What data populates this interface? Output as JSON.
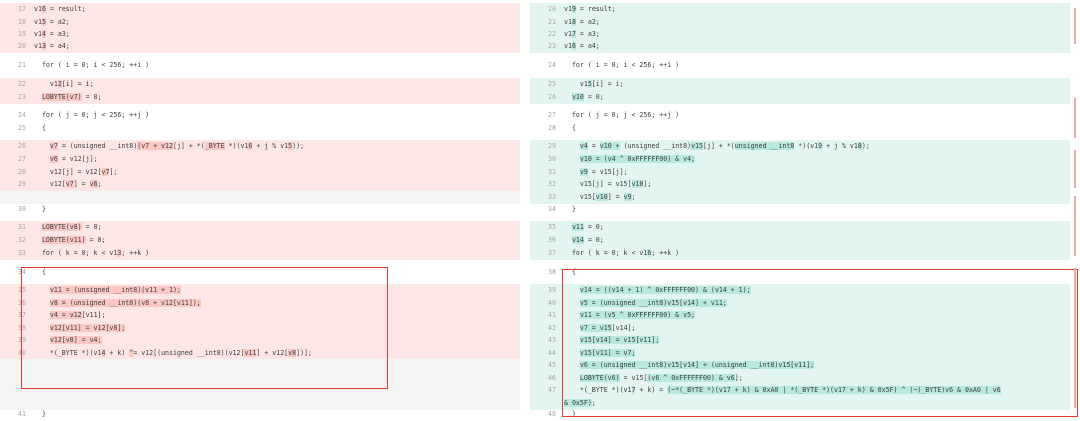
{
  "left": [
    {
      "ln": "17",
      "cls": "del",
      "parts": [
        {
          "t": "v1"
        },
        {
          "t": "6",
          "h": 1
        },
        {
          "t": " = result;"
        }
      ]
    },
    {
      "ln": "18",
      "cls": "del",
      "parts": [
        {
          "t": "v1"
        },
        {
          "t": "5",
          "h": 1
        },
        {
          "t": " = a2;"
        }
      ]
    },
    {
      "ln": "19",
      "cls": "del",
      "parts": [
        {
          "t": "v1"
        },
        {
          "t": "4",
          "h": 1
        },
        {
          "t": " = a3;"
        }
      ]
    },
    {
      "ln": "20",
      "cls": "del",
      "parts": [
        {
          "t": "v1"
        },
        {
          "t": "3",
          "h": 1
        },
        {
          "t": " = a4;"
        }
      ]
    },
    {
      "ln": "21",
      "cls": "",
      "parts": [
        {
          "t": "  for ( i = 0; i < 256; ++i )"
        }
      ]
    },
    {
      "ln": "22",
      "cls": "del",
      "parts": [
        {
          "t": "    v1"
        },
        {
          "t": "2",
          "h": 1
        },
        {
          "t": "[i] = i;"
        }
      ]
    },
    {
      "ln": "23",
      "cls": "del",
      "parts": [
        {
          "t": "  "
        },
        {
          "t": "LOBYTE(v7)",
          "h": 1
        },
        {
          "t": " = 0;"
        }
      ]
    },
    {
      "ln": "24",
      "cls": "",
      "parts": [
        {
          "t": "  for ( j = 0; j < 256; ++j )"
        }
      ]
    },
    {
      "ln": "25",
      "cls": "",
      "parts": [
        {
          "t": "  {"
        }
      ]
    },
    {
      "ln": "26",
      "cls": "del",
      "parts": [
        {
          "t": "    "
        },
        {
          "t": "v7",
          "h": 1
        },
        {
          "t": " = (unsigned __int8)"
        },
        {
          "t": "(v7 + v12",
          "h": 1
        },
        {
          "t": "[j] + *("
        },
        {
          "t": "_BYTE",
          "h": 1
        },
        {
          "t": " *)(v1"
        },
        {
          "t": "6",
          "h": 1
        },
        {
          "t": " + j % v1"
        },
        {
          "t": "5",
          "h": 1
        },
        {
          "t": "));"
        }
      ]
    },
    {
      "ln": "27",
      "cls": "del",
      "parts": [
        {
          "t": "    "
        },
        {
          "t": "v6",
          "h": 1
        },
        {
          "t": " = v12[j];"
        }
      ]
    },
    {
      "ln": "28",
      "cls": "del",
      "parts": [
        {
          "t": "    v12[j] = v12["
        },
        {
          "t": "v7",
          "h": 1
        },
        {
          "t": "];"
        }
      ]
    },
    {
      "ln": "29",
      "cls": "del",
      "parts": [
        {
          "t": "    v12["
        },
        {
          "t": "v7",
          "h": 1
        },
        {
          "t": "] = "
        },
        {
          "t": "v6",
          "h": 1
        },
        {
          "t": ";"
        }
      ]
    },
    {
      "ln": "",
      "cls": "empty",
      "parts": []
    },
    {
      "ln": "30",
      "cls": "",
      "parts": [
        {
          "t": "  }"
        }
      ]
    },
    {
      "ln": "31",
      "cls": "del",
      "parts": [
        {
          "t": "  "
        },
        {
          "t": "LOBYTE(v8)",
          "h": 1
        },
        {
          "t": " = 0;"
        }
      ]
    },
    {
      "ln": "32",
      "cls": "del",
      "parts": [
        {
          "t": "  "
        },
        {
          "t": "LOBYTE(v11)",
          "h": 1
        },
        {
          "t": " = 0;"
        }
      ]
    },
    {
      "ln": "33",
      "cls": "del",
      "parts": [
        {
          "t": "  for ( k = 0; k < v1"
        },
        {
          "t": "3",
          "h": 1
        },
        {
          "t": "; ++k )"
        }
      ]
    },
    {
      "ln": "34",
      "cls": "",
      "parts": [
        {
          "t": "  {"
        }
      ]
    },
    {
      "ln": "35",
      "cls": "del",
      "parts": [
        {
          "t": "    "
        },
        {
          "t": "v11 = (unsigned __int8)(v11 + 1);",
          "h": 1
        }
      ]
    },
    {
      "ln": "36",
      "cls": "del",
      "parts": [
        {
          "t": "    "
        },
        {
          "t": "v8 = (unsigned __int8)(v8 + v12[v11]);",
          "h": 1
        }
      ]
    },
    {
      "ln": "37",
      "cls": "del",
      "parts": [
        {
          "t": "    "
        },
        {
          "t": "v4 = v12",
          "h": 1
        },
        {
          "t": "[v11];"
        }
      ]
    },
    {
      "ln": "38",
      "cls": "del",
      "parts": [
        {
          "t": "    "
        },
        {
          "t": "v12[v11] = v12[v8];",
          "h": 1
        }
      ]
    },
    {
      "ln": "39",
      "cls": "del",
      "parts": [
        {
          "t": "    "
        },
        {
          "t": "v12[v8] = v4;",
          "h": 1
        }
      ]
    },
    {
      "ln": "40",
      "cls": "del",
      "parts": [
        {
          "t": "    *(_BYTE *)(v1"
        },
        {
          "t": "4",
          "h": 1
        },
        {
          "t": " + k) "
        },
        {
          "t": "^",
          "h": 1
        },
        {
          "t": "= v12[(unsigned __int8)(v12["
        },
        {
          "t": "v11",
          "h": 1
        },
        {
          "t": "] + v12["
        },
        {
          "t": "v8",
          "h": 1
        },
        {
          "t": "])];"
        }
      ]
    },
    {
      "ln": "",
      "cls": "empty",
      "parts": []
    },
    {
      "ln": "",
      "cls": "empty",
      "parts": []
    },
    {
      "ln": "",
      "cls": "empty",
      "parts": []
    },
    {
      "ln": "",
      "cls": "empty",
      "parts": []
    },
    {
      "ln": "",
      "cls": "empty",
      "parts": []
    },
    {
      "ln": "",
      "cls": "",
      "parts": []
    },
    {
      "ln": "41",
      "cls": "",
      "parts": [
        {
          "t": "  }"
        }
      ]
    }
  ],
  "right": [
    {
      "ln": "20",
      "cls": "add",
      "parts": [
        {
          "t": "v1"
        },
        {
          "t": "9",
          "h": 1
        },
        {
          "t": " = result;"
        }
      ]
    },
    {
      "ln": "21",
      "cls": "add",
      "parts": [
        {
          "t": "v1"
        },
        {
          "t": "8",
          "h": 1
        },
        {
          "t": " = a2;"
        }
      ]
    },
    {
      "ln": "22",
      "cls": "add",
      "parts": [
        {
          "t": "v1"
        },
        {
          "t": "7",
          "h": 1
        },
        {
          "t": " = a3;"
        }
      ]
    },
    {
      "ln": "23",
      "cls": "add",
      "parts": [
        {
          "t": "v1"
        },
        {
          "t": "6",
          "h": 1
        },
        {
          "t": " = a4;"
        }
      ]
    },
    {
      "ln": "24",
      "cls": "",
      "parts": [
        {
          "t": "  for ( i = 0; i < 256; ++i )"
        }
      ]
    },
    {
      "ln": "25",
      "cls": "add",
      "parts": [
        {
          "t": "    v1"
        },
        {
          "t": "5",
          "h": 1
        },
        {
          "t": "[i] = i;"
        }
      ]
    },
    {
      "ln": "26",
      "cls": "add",
      "parts": [
        {
          "t": "  "
        },
        {
          "t": "v10",
          "h": 1
        },
        {
          "t": " = 0;"
        }
      ]
    },
    {
      "ln": "27",
      "cls": "",
      "parts": [
        {
          "t": "  for ( j = 0; j < 256; ++j )"
        }
      ]
    },
    {
      "ln": "28",
      "cls": "",
      "parts": [
        {
          "t": "  {"
        }
      ]
    },
    {
      "ln": "29",
      "cls": "add",
      "parts": [
        {
          "t": "    "
        },
        {
          "t": "v4",
          "h": 1
        },
        {
          "t": " = "
        },
        {
          "t": "v10 +",
          "h": 1
        },
        {
          "t": " (unsigned __int8)"
        },
        {
          "t": "v15",
          "h": 1
        },
        {
          "t": "[j] + *("
        },
        {
          "t": "unsigned __int8",
          "h": 1
        },
        {
          "t": " *)(v1"
        },
        {
          "t": "9",
          "h": 1
        },
        {
          "t": " + j % v1"
        },
        {
          "t": "8",
          "h": 1
        },
        {
          "t": ");"
        }
      ]
    },
    {
      "ln": "30",
      "cls": "add",
      "parts": [
        {
          "t": "    "
        },
        {
          "t": "v10 = (v4 ^ 0xFFFFFF00) & v4;",
          "h": 1
        }
      ]
    },
    {
      "ln": "31",
      "cls": "add",
      "parts": [
        {
          "t": "    "
        },
        {
          "t": "v9",
          "h": 1
        },
        {
          "t": " = v15[j];"
        }
      ]
    },
    {
      "ln": "32",
      "cls": "add",
      "parts": [
        {
          "t": "    v15[j] = v15["
        },
        {
          "t": "v10",
          "h": 1
        },
        {
          "t": "];"
        }
      ]
    },
    {
      "ln": "33",
      "cls": "add",
      "parts": [
        {
          "t": "    v15["
        },
        {
          "t": "v10",
          "h": 1
        },
        {
          "t": "] = "
        },
        {
          "t": "v9",
          "h": 1
        },
        {
          "t": ";"
        }
      ]
    },
    {
      "ln": "34",
      "cls": "",
      "parts": [
        {
          "t": "  }"
        }
      ]
    },
    {
      "ln": "35",
      "cls": "add",
      "parts": [
        {
          "t": "  "
        },
        {
          "t": "v11",
          "h": 1
        },
        {
          "t": " = 0;"
        }
      ]
    },
    {
      "ln": "36",
      "cls": "add",
      "parts": [
        {
          "t": "  "
        },
        {
          "t": "v14",
          "h": 1
        },
        {
          "t": " = 0;"
        }
      ]
    },
    {
      "ln": "37",
      "cls": "add",
      "parts": [
        {
          "t": "  for ( k = 0; k < v1"
        },
        {
          "t": "6",
          "h": 1
        },
        {
          "t": "; ++k )"
        }
      ]
    },
    {
      "ln": "38",
      "cls": "",
      "parts": [
        {
          "t": "  {"
        }
      ]
    },
    {
      "ln": "39",
      "cls": "add",
      "parts": [
        {
          "t": "    "
        },
        {
          "t": "v14 = ((v14 + 1) ^ 0xFFFFFF00) & (v14 + 1);",
          "h": 1
        }
      ]
    },
    {
      "ln": "40",
      "cls": "add",
      "parts": [
        {
          "t": "    "
        },
        {
          "t": "v5 = (unsigned __int8)v15[v14] + v11;",
          "h": 1
        }
      ]
    },
    {
      "ln": "41",
      "cls": "add",
      "parts": [
        {
          "t": "    "
        },
        {
          "t": "v11 = (v5 ^ 0xFFFFFF00) & v5;",
          "h": 1
        }
      ]
    },
    {
      "ln": "42",
      "cls": "add",
      "parts": [
        {
          "t": "    "
        },
        {
          "t": "v7 = v15",
          "h": 1
        },
        {
          "t": "[v14];"
        }
      ]
    },
    {
      "ln": "43",
      "cls": "add",
      "parts": [
        {
          "t": "    "
        },
        {
          "t": "v15[v14] = v15[v11];",
          "h": 1
        }
      ]
    },
    {
      "ln": "44",
      "cls": "add",
      "parts": [
        {
          "t": "    "
        },
        {
          "t": "v15[v11] = v7;",
          "h": 1
        }
      ]
    },
    {
      "ln": "45",
      "cls": "add",
      "parts": [
        {
          "t": "    "
        },
        {
          "t": "v6 = (unsigned __int8)v15[v14] + (unsigned __int8)v15[v11];",
          "h": 1
        }
      ]
    },
    {
      "ln": "46",
      "cls": "add",
      "parts": [
        {
          "t": "    "
        },
        {
          "t": "LOBYTE(v6)",
          "h": 1
        },
        {
          "t": " = v15["
        },
        {
          "t": "(v6 ^ 0xFFFFFF00) & v6",
          "h": 1
        },
        {
          "t": "];"
        }
      ]
    },
    {
      "ln": "47",
      "cls": "add",
      "parts": [
        {
          "t": "    *(_BYTE *)(v1"
        },
        {
          "t": "7",
          "h": 1
        },
        {
          "t": " + k) = "
        },
        {
          "t": "(~*(_BYTE *)(v17 + k) & 0xA0 | *(_BYTE *)(v17 + k) & 0x5F) ^ (~(_BYTE)v6 & 0xA0 | v6",
          "h": 1
        }
      ]
    },
    {
      "ln": "",
      "cls": "add",
      "parts": [
        {
          "t": "& 0x5F)",
          "h": 1
        },
        {
          "t": ";"
        }
      ]
    },
    {
      "ln": "48",
      "cls": "",
      "parts": [
        {
          "t": "  }"
        }
      ]
    }
  ]
}
